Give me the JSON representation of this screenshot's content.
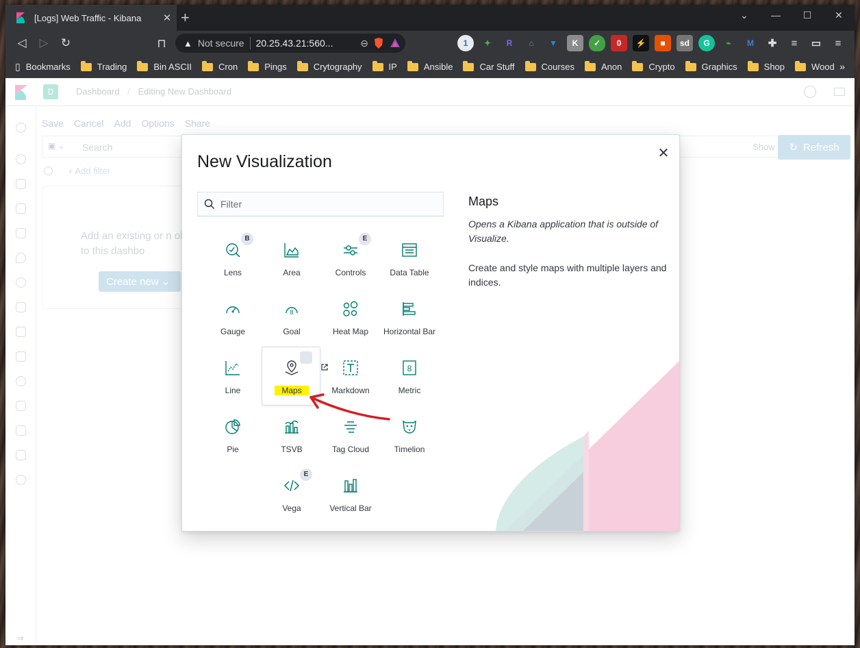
{
  "browser": {
    "tab_title": "[Logs] Web Traffic - Kibana",
    "tab_close": "✕",
    "new_tab": "+",
    "not_secure": "Not secure",
    "url": "20.25.43.21:560...",
    "bookmarks": [
      "Bookmarks",
      "Trading",
      "Bin ASCII",
      "Cron",
      "Pings",
      "Crytography",
      "IP",
      "Ansible",
      "Car Stuff",
      "Courses",
      "Anon",
      "Crypto",
      "Graphics",
      "Shop",
      "Wood"
    ],
    "bookmarks_more": "»",
    "extensions": [
      "1P",
      "bird",
      "R",
      "sense",
      "B",
      "K",
      "shield",
      "0",
      "zap",
      "lock",
      "sd",
      "G",
      "plug",
      "M",
      "puzzle",
      "queue",
      "wallet",
      "menu"
    ]
  },
  "kibana": {
    "space": "D",
    "breadcrumbs": [
      "Dashboard",
      "Editing New Dashboard"
    ],
    "top_menu": [
      "Save",
      "Cancel",
      "Add",
      "Options",
      "Share"
    ],
    "search_placeholder": "Search",
    "show_dates": "Show dates",
    "refresh_label": "Refresh",
    "add_filter": "+ Add filter",
    "empty_text": "Add an existing or n object to this dashbo",
    "create_new": "Create new"
  },
  "modal": {
    "title": "New Visualization",
    "close_icon": "close-icon",
    "filter_placeholder": "Filter",
    "visualizations": [
      {
        "label": "Lens",
        "icon": "lens-icon",
        "badge": "B"
      },
      {
        "label": "Area",
        "icon": "area-chart-icon"
      },
      {
        "label": "Controls",
        "icon": "controls-icon",
        "badge": "E"
      },
      {
        "label": "Data Table",
        "icon": "data-table-icon"
      },
      {
        "label": "Gauge",
        "icon": "gauge-icon"
      },
      {
        "label": "Goal",
        "icon": "goal-icon"
      },
      {
        "label": "Heat Map",
        "icon": "heat-map-icon"
      },
      {
        "label": "Horizontal Bar",
        "icon": "horizontal-bar-icon"
      },
      {
        "label": "Line",
        "icon": "line-chart-icon"
      },
      {
        "label": "Maps",
        "icon": "maps-icon",
        "external": true,
        "selected": true
      },
      {
        "label": "Markdown",
        "icon": "markdown-icon"
      },
      {
        "label": "Metric",
        "icon": "metric-icon"
      },
      {
        "label": "Pie",
        "icon": "pie-chart-icon"
      },
      {
        "label": "TSVB",
        "icon": "tsvb-icon"
      },
      {
        "label": "Tag Cloud",
        "icon": "tag-cloud-icon"
      },
      {
        "label": "Timelion",
        "icon": "timelion-icon"
      },
      {
        "label": "Vega",
        "icon": "vega-icon",
        "badge": "E"
      },
      {
        "label": "Vertical Bar",
        "icon": "vertical-bar-icon"
      }
    ],
    "description": {
      "title": "Maps",
      "italic": "Opens a Kibana application that is outside of Visualize.",
      "body": "Create and style maps with multiple layers and indices."
    }
  },
  "colors": {
    "accent": "#017d73",
    "highlight": "#fff200",
    "arrow": "#d31f26"
  }
}
